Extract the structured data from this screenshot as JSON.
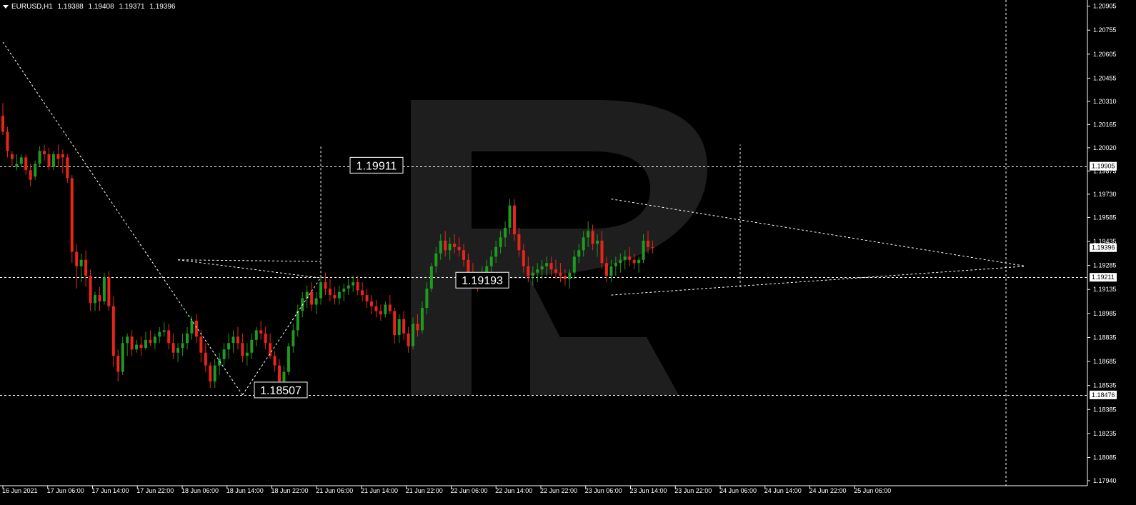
{
  "header": {
    "symbol": "EURUSD,H1",
    "open": "1.19388",
    "high": "1.19408",
    "low": "1.19371",
    "close": "1.19396"
  },
  "colors": {
    "background": "#000000",
    "bull": "#1f9b1f",
    "bear": "#e8251b",
    "grid": "#ffffff",
    "text": "#ffffff",
    "watermark": "#1e1e1e"
  },
  "watermark": {
    "icon": "r-logo-icon"
  },
  "chart_data": {
    "type": "candlestick",
    "symbol": "EURUSD",
    "timeframe": "H1",
    "ylim": [
      1.1794,
      1.2093
    ],
    "y_ticks": [
      "1.20905",
      "1.20755",
      "1.20605",
      "1.20455",
      "1.20310",
      "1.20165",
      "1.20020",
      "1.19875",
      "1.19730",
      "1.19585",
      "1.19435",
      "1.19285",
      "1.19135",
      "1.18985",
      "1.18835",
      "1.18685",
      "1.18535",
      "1.18385",
      "1.18235",
      "1.18085",
      "1.17940"
    ],
    "x_ticks": [
      "16 Jun 2021",
      "17 Jun 06:00",
      "17 Jun 14:00",
      "17 Jun 22:00",
      "18 Jun 06:00",
      "18 Jun 14:00",
      "18 Jun 22:00",
      "21 Jun 06:00",
      "21 Jun 14:00",
      "21 Jun 22:00",
      "22 Jun 06:00",
      "22 Jun 14:00",
      "22 Jun 22:00",
      "23 Jun 06:00",
      "23 Jun 14:00",
      "23 Jun 22:00",
      "24 Jun 06:00",
      "24 Jun 14:00",
      "24 Jun 22:00",
      "25 Jun 06:00"
    ],
    "price_badges": [
      {
        "label": "1.19905",
        "value": 1.19905
      },
      {
        "label": "1.19396",
        "value": 1.19396
      },
      {
        "label": "1.19211",
        "value": 1.19211
      },
      {
        "label": "1.18476",
        "value": 1.18476
      }
    ],
    "level_labels": [
      {
        "label": "1.19911",
        "value": 1.19911
      },
      {
        "label": "1.19193",
        "value": 1.19193
      },
      {
        "label": "1.18507",
        "value": 1.18507
      }
    ],
    "horizontal_levels": [
      1.19905,
      1.19211,
      1.18476
    ],
    "vertical_marker_bar": 160,
    "candles": [
      [
        1.2022,
        1.203,
        1.201,
        1.2012
      ],
      [
        1.2012,
        1.2015,
        1.1996,
        1.2
      ],
      [
        1.1998,
        1.2,
        1.199,
        1.1995
      ],
      [
        1.199,
        1.1998,
        1.1988,
        1.1992
      ],
      [
        1.1992,
        1.1998,
        1.199,
        1.1996
      ],
      [
        1.1996,
        1.1998,
        1.1985,
        1.1988
      ],
      [
        1.1988,
        1.1992,
        1.1978,
        1.1982
      ],
      [
        1.1984,
        1.1994,
        1.1982,
        1.1992
      ],
      [
        1.1992,
        1.2003,
        1.199,
        1.2
      ],
      [
        1.2,
        1.2004,
        1.1994,
        1.1998
      ],
      [
        1.1998,
        1.2002,
        1.1988,
        1.199
      ],
      [
        1.199,
        1.2,
        1.1988,
        1.1998
      ],
      [
        1.1998,
        1.2004,
        1.199,
        1.1995
      ],
      [
        1.1998,
        1.2001,
        1.1986,
        1.1996
      ],
      [
        1.1996,
        1.1998,
        1.198,
        1.1983
      ],
      [
        1.1983,
        1.1985,
        1.193,
        1.1937
      ],
      [
        1.1937,
        1.1942,
        1.1914,
        1.1928
      ],
      [
        1.1928,
        1.1936,
        1.1918,
        1.1932
      ],
      [
        1.1932,
        1.1938,
        1.1915,
        1.1922
      ],
      [
        1.1922,
        1.1926,
        1.19,
        1.1905
      ],
      [
        1.1905,
        1.1912,
        1.19,
        1.191
      ],
      [
        1.191,
        1.1915,
        1.19,
        1.1906
      ],
      [
        1.1906,
        1.1924,
        1.1904,
        1.1921
      ],
      [
        1.1921,
        1.1925,
        1.19,
        1.1903
      ],
      [
        1.1903,
        1.1909,
        1.1865,
        1.1872
      ],
      [
        1.1872,
        1.1876,
        1.1856,
        1.1862
      ],
      [
        1.1862,
        1.1884,
        1.186,
        1.188
      ],
      [
        1.188,
        1.1886,
        1.1872,
        1.1884
      ],
      [
        1.1884,
        1.1888,
        1.1872,
        1.1876
      ],
      [
        1.1876,
        1.1882,
        1.1874,
        1.1879
      ],
      [
        1.1879,
        1.1884,
        1.1872,
        1.1877
      ],
      [
        1.1877,
        1.1887,
        1.1876,
        1.1882
      ],
      [
        1.1882,
        1.1888,
        1.1878,
        1.188
      ],
      [
        1.188,
        1.1886,
        1.1876,
        1.1884
      ],
      [
        1.1884,
        1.189,
        1.188,
        1.1887
      ],
      [
        1.1887,
        1.1893,
        1.1884,
        1.1888
      ],
      [
        1.1888,
        1.1892,
        1.1876,
        1.188
      ],
      [
        1.188,
        1.1886,
        1.187,
        1.1874
      ],
      [
        1.1874,
        1.188,
        1.1868,
        1.1877
      ],
      [
        1.1877,
        1.1886,
        1.1872,
        1.188
      ],
      [
        1.188,
        1.189,
        1.1876,
        1.1886
      ],
      [
        1.1886,
        1.1897,
        1.1882,
        1.1894
      ],
      [
        1.1894,
        1.1898,
        1.188,
        1.1884
      ],
      [
        1.1884,
        1.1888,
        1.1868,
        1.1874
      ],
      [
        1.1874,
        1.188,
        1.1862,
        1.1866
      ],
      [
        1.1866,
        1.1868,
        1.1852,
        1.1856
      ],
      [
        1.1856,
        1.187,
        1.1852,
        1.1866
      ],
      [
        1.1866,
        1.1874,
        1.186,
        1.187
      ],
      [
        1.187,
        1.188,
        1.1866,
        1.1876
      ],
      [
        1.1876,
        1.1886,
        1.187,
        1.188
      ],
      [
        1.188,
        1.1888,
        1.1874,
        1.1884
      ],
      [
        1.1884,
        1.189,
        1.1876,
        1.188
      ],
      [
        1.188,
        1.1886,
        1.1868,
        1.1872
      ],
      [
        1.1872,
        1.188,
        1.1866,
        1.1874
      ],
      [
        1.1874,
        1.1886,
        1.187,
        1.1882
      ],
      [
        1.1882,
        1.189,
        1.1878,
        1.1888
      ],
      [
        1.1888,
        1.1894,
        1.1882,
        1.1886
      ],
      [
        1.1886,
        1.189,
        1.1876,
        1.188
      ],
      [
        1.188,
        1.1886,
        1.187,
        1.1872
      ],
      [
        1.1872,
        1.1875,
        1.1862,
        1.1866
      ],
      [
        1.1866,
        1.187,
        1.1852,
        1.1856
      ],
      [
        1.1856,
        1.1866,
        1.1852,
        1.1862
      ],
      [
        1.1862,
        1.188,
        1.186,
        1.1878
      ],
      [
        1.1878,
        1.1892,
        1.1874,
        1.1888
      ],
      [
        1.1888,
        1.1904,
        1.1884,
        1.19
      ],
      [
        1.19,
        1.1912,
        1.1896,
        1.1908
      ],
      [
        1.1908,
        1.1916,
        1.1902,
        1.1912
      ],
      [
        1.1912,
        1.1918,
        1.19,
        1.1904
      ],
      [
        1.1904,
        1.1912,
        1.1898,
        1.1908
      ],
      [
        1.1908,
        1.1922,
        1.1904,
        1.1918
      ],
      [
        1.1918,
        1.1924,
        1.191,
        1.1914
      ],
      [
        1.1914,
        1.192,
        1.1906,
        1.191
      ],
      [
        1.191,
        1.1915,
        1.1904,
        1.1908
      ],
      [
        1.1908,
        1.1916,
        1.1904,
        1.1912
      ],
      [
        1.1912,
        1.1917,
        1.1906,
        1.1914
      ],
      [
        1.1914,
        1.192,
        1.191,
        1.1916
      ],
      [
        1.1916,
        1.1922,
        1.1912,
        1.1918
      ],
      [
        1.1918,
        1.1922,
        1.191,
        1.1913
      ],
      [
        1.1913,
        1.1918,
        1.1906,
        1.191
      ],
      [
        1.191,
        1.1914,
        1.1902,
        1.1906
      ],
      [
        1.1906,
        1.191,
        1.1898,
        1.1903
      ],
      [
        1.1903,
        1.1907,
        1.1896,
        1.19
      ],
      [
        1.19,
        1.1904,
        1.1894,
        1.1898
      ],
      [
        1.1898,
        1.1906,
        1.1896,
        1.1904
      ],
      [
        1.1904,
        1.191,
        1.1898,
        1.19
      ],
      [
        1.19,
        1.1902,
        1.188,
        1.1885
      ],
      [
        1.1885,
        1.1898,
        1.188,
        1.1895
      ],
      [
        1.1895,
        1.19,
        1.1882,
        1.1886
      ],
      [
        1.1886,
        1.189,
        1.1874,
        1.1878
      ],
      [
        1.1878,
        1.1896,
        1.1876,
        1.1892
      ],
      [
        1.1892,
        1.1898,
        1.1884,
        1.1888
      ],
      [
        1.1888,
        1.1906,
        1.1886,
        1.1902
      ],
      [
        1.1902,
        1.1918,
        1.1898,
        1.1914
      ],
      [
        1.1914,
        1.193,
        1.1912,
        1.1928
      ],
      [
        1.1928,
        1.194,
        1.1924,
        1.1936
      ],
      [
        1.1936,
        1.1948,
        1.1932,
        1.1944
      ],
      [
        1.1944,
        1.195,
        1.1934,
        1.1938
      ],
      [
        1.1938,
        1.1946,
        1.1932,
        1.1942
      ],
      [
        1.1942,
        1.1948,
        1.1936,
        1.194
      ],
      [
        1.194,
        1.1946,
        1.1934,
        1.1938
      ],
      [
        1.1938,
        1.1942,
        1.1928,
        1.1932
      ],
      [
        1.1932,
        1.1936,
        1.192,
        1.1924
      ],
      [
        1.1924,
        1.193,
        1.1916,
        1.192
      ],
      [
        1.192,
        1.1924,
        1.1912,
        1.1916
      ],
      [
        1.1916,
        1.1928,
        1.1914,
        1.1924
      ],
      [
        1.1924,
        1.1932,
        1.1918,
        1.1928
      ],
      [
        1.1928,
        1.1938,
        1.1924,
        1.1934
      ],
      [
        1.1934,
        1.1944,
        1.193,
        1.194
      ],
      [
        1.194,
        1.195,
        1.1936,
        1.1946
      ],
      [
        1.1946,
        1.1956,
        1.194,
        1.1952
      ],
      [
        1.1952,
        1.197,
        1.1948,
        1.1966
      ],
      [
        1.1966,
        1.197,
        1.1944,
        1.1948
      ],
      [
        1.1948,
        1.1952,
        1.1934,
        1.1938
      ],
      [
        1.1938,
        1.1942,
        1.1924,
        1.1928
      ],
      [
        1.1928,
        1.1934,
        1.1918,
        1.1922
      ],
      [
        1.1922,
        1.1928,
        1.1916,
        1.1924
      ],
      [
        1.1924,
        1.193,
        1.1918,
        1.1926
      ],
      [
        1.1926,
        1.1932,
        1.192,
        1.1928
      ],
      [
        1.1928,
        1.1934,
        1.1922,
        1.193
      ],
      [
        1.193,
        1.1934,
        1.1922,
        1.1926
      ],
      [
        1.1926,
        1.1932,
        1.192,
        1.1924
      ],
      [
        1.1924,
        1.193,
        1.1918,
        1.1922
      ],
      [
        1.1922,
        1.1926,
        1.1916,
        1.192
      ],
      [
        1.192,
        1.1926,
        1.1914,
        1.1924
      ],
      [
        1.1924,
        1.1938,
        1.192,
        1.1934
      ],
      [
        1.1934,
        1.1942,
        1.193,
        1.1938
      ],
      [
        1.1938,
        1.195,
        1.1934,
        1.1946
      ],
      [
        1.1946,
        1.1956,
        1.194,
        1.195
      ],
      [
        1.195,
        1.1954,
        1.1938,
        1.1942
      ],
      [
        1.1942,
        1.1948,
        1.1934,
        1.1944
      ],
      [
        1.1944,
        1.195,
        1.1926,
        1.193
      ],
      [
        1.193,
        1.1934,
        1.1918,
        1.1922
      ],
      [
        1.1922,
        1.1932,
        1.1918,
        1.1928
      ],
      [
        1.1928,
        1.1934,
        1.1922,
        1.193
      ],
      [
        1.193,
        1.1936,
        1.1924,
        1.1932
      ],
      [
        1.1932,
        1.1938,
        1.1926,
        1.1934
      ],
      [
        1.1934,
        1.194,
        1.1928,
        1.1932
      ],
      [
        1.1932,
        1.1936,
        1.1926,
        1.193
      ],
      [
        1.193,
        1.1934,
        1.1924,
        1.1932
      ],
      [
        1.1932,
        1.1948,
        1.193,
        1.1944
      ],
      [
        1.1944,
        1.195,
        1.1936,
        1.194
      ],
      [
        1.194,
        1.1944,
        1.1936,
        1.19396
      ]
    ]
  }
}
